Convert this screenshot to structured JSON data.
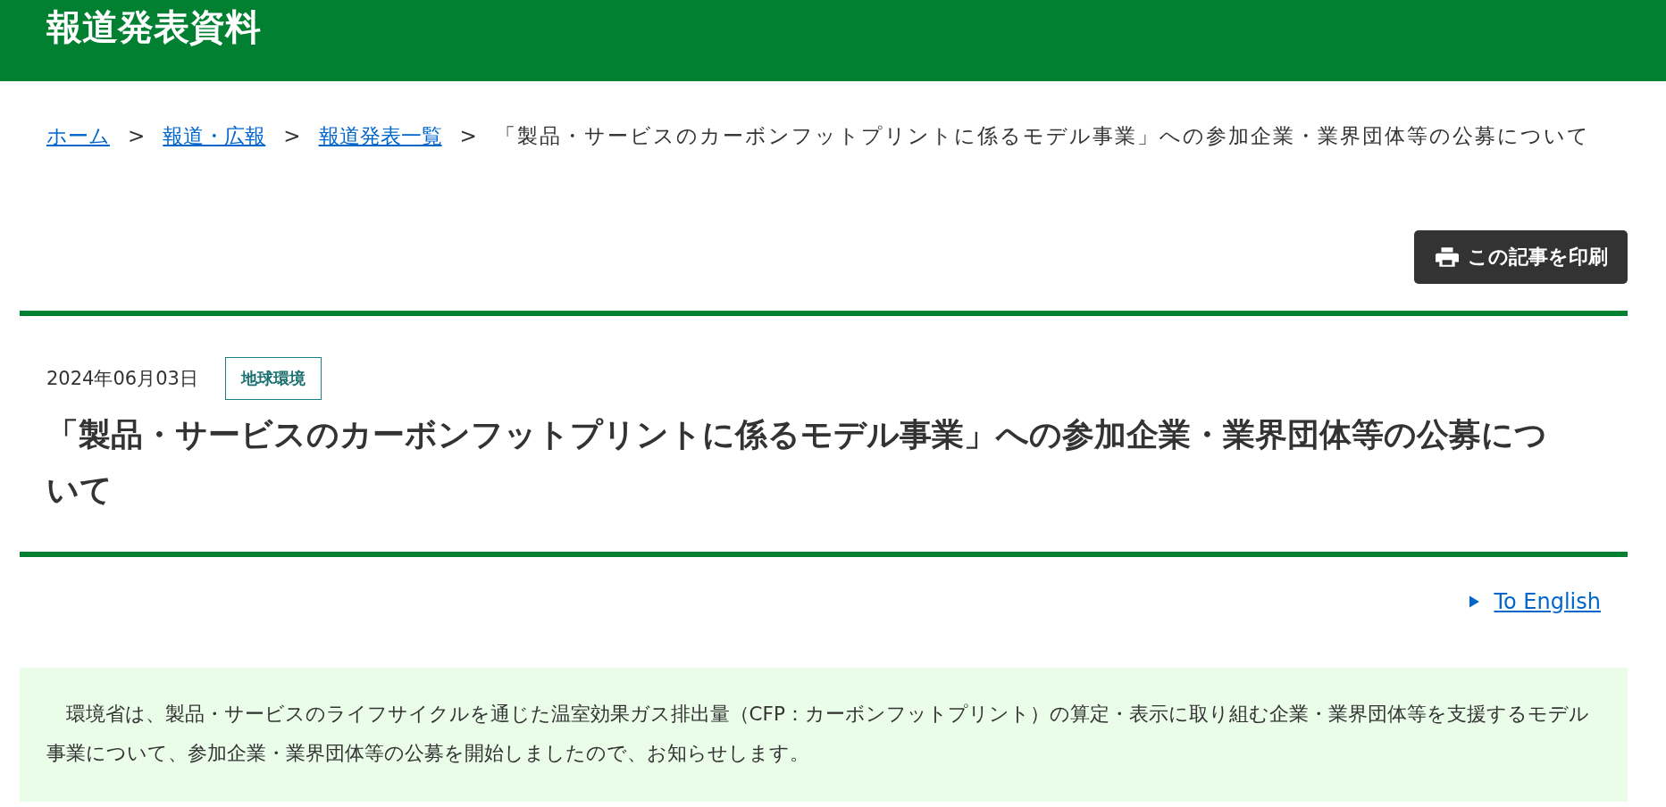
{
  "header": {
    "title": "報道発表資料"
  },
  "breadcrumb": [
    {
      "label": "ホーム",
      "link": true
    },
    {
      "label": "報道・広報",
      "link": true
    },
    {
      "label": "報道発表一覧",
      "link": true
    },
    {
      "label": "「製品・サービスのカーボンフットプリントに係るモデル事業」への参加企業・業界団体等の公募について",
      "link": false
    }
  ],
  "breadcrumb_separator": ">",
  "print_button": {
    "label": "この記事を印刷"
  },
  "article": {
    "date": "2024年06月03日",
    "tag": "地球環境",
    "title": "「製品・サービスのカーボンフットプリントに係るモデル事業」への参加企業・業界団体等の公募について"
  },
  "language_link": {
    "label": "To English"
  },
  "summary": "環境省は、製品・サービスのライフサイクルを通じた温室効果ガス排出量（CFP：カーボンフットプリント）の算定・表示に取り組む企業・業界団体等を支援するモデル事業について、参加企業・業界団体等の公募を開始しましたので、お知らせします。"
}
